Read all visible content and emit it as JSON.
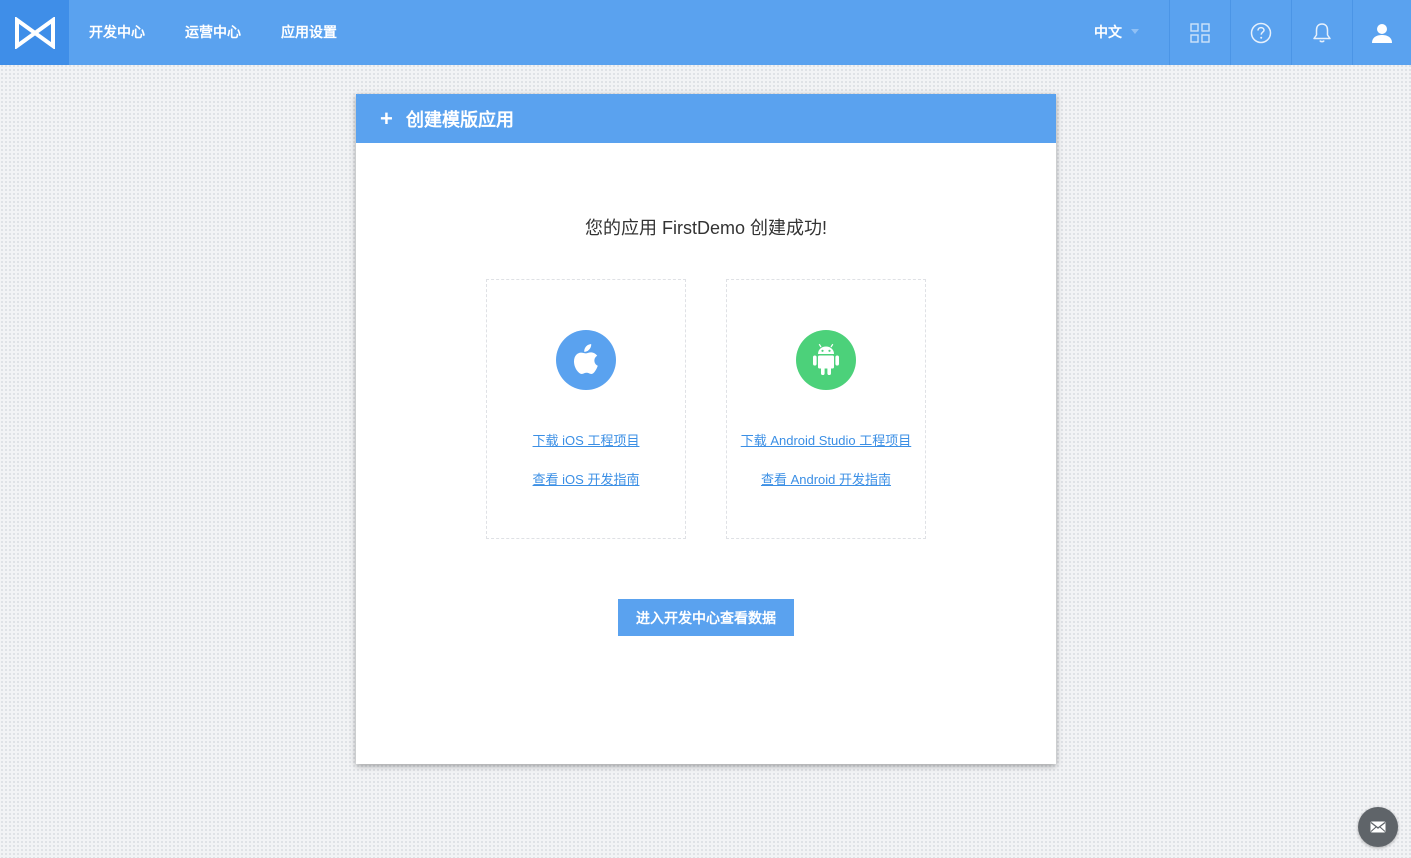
{
  "header": {
    "logo_icon": "bowtie-logo-icon",
    "nav": [
      {
        "label": "开发中心"
      },
      {
        "label": "运营中心"
      },
      {
        "label": "应用设置"
      }
    ],
    "language": {
      "label": "中文",
      "icon": "caret-down-icon"
    },
    "icons": [
      "grid-apps-icon",
      "help-circle-icon",
      "bell-icon",
      "user-icon"
    ]
  },
  "card": {
    "header_icon": "plus-icon",
    "header_title": "创建模版应用",
    "success_message": "您的应用 FirstDemo 创建成功!",
    "platforms": {
      "ios": {
        "icon": "apple-icon",
        "color": "#5aa2ef",
        "download_link": "下载 iOS 工程项目",
        "guide_link": "查看 iOS 开发指南"
      },
      "android": {
        "icon": "android-icon",
        "color": "#4cd17a",
        "download_link": "下载 Android Studio 工程项目",
        "guide_link": "查看 Android 开发指南"
      }
    },
    "cta_label": "进入开发中心查看数据"
  },
  "feedback_icon": "mail-icon",
  "colors": {
    "primary": "#5aa2ef",
    "primary_dark": "#3f8ee8",
    "link": "#3b8fe5",
    "android_green": "#4cd17a"
  }
}
